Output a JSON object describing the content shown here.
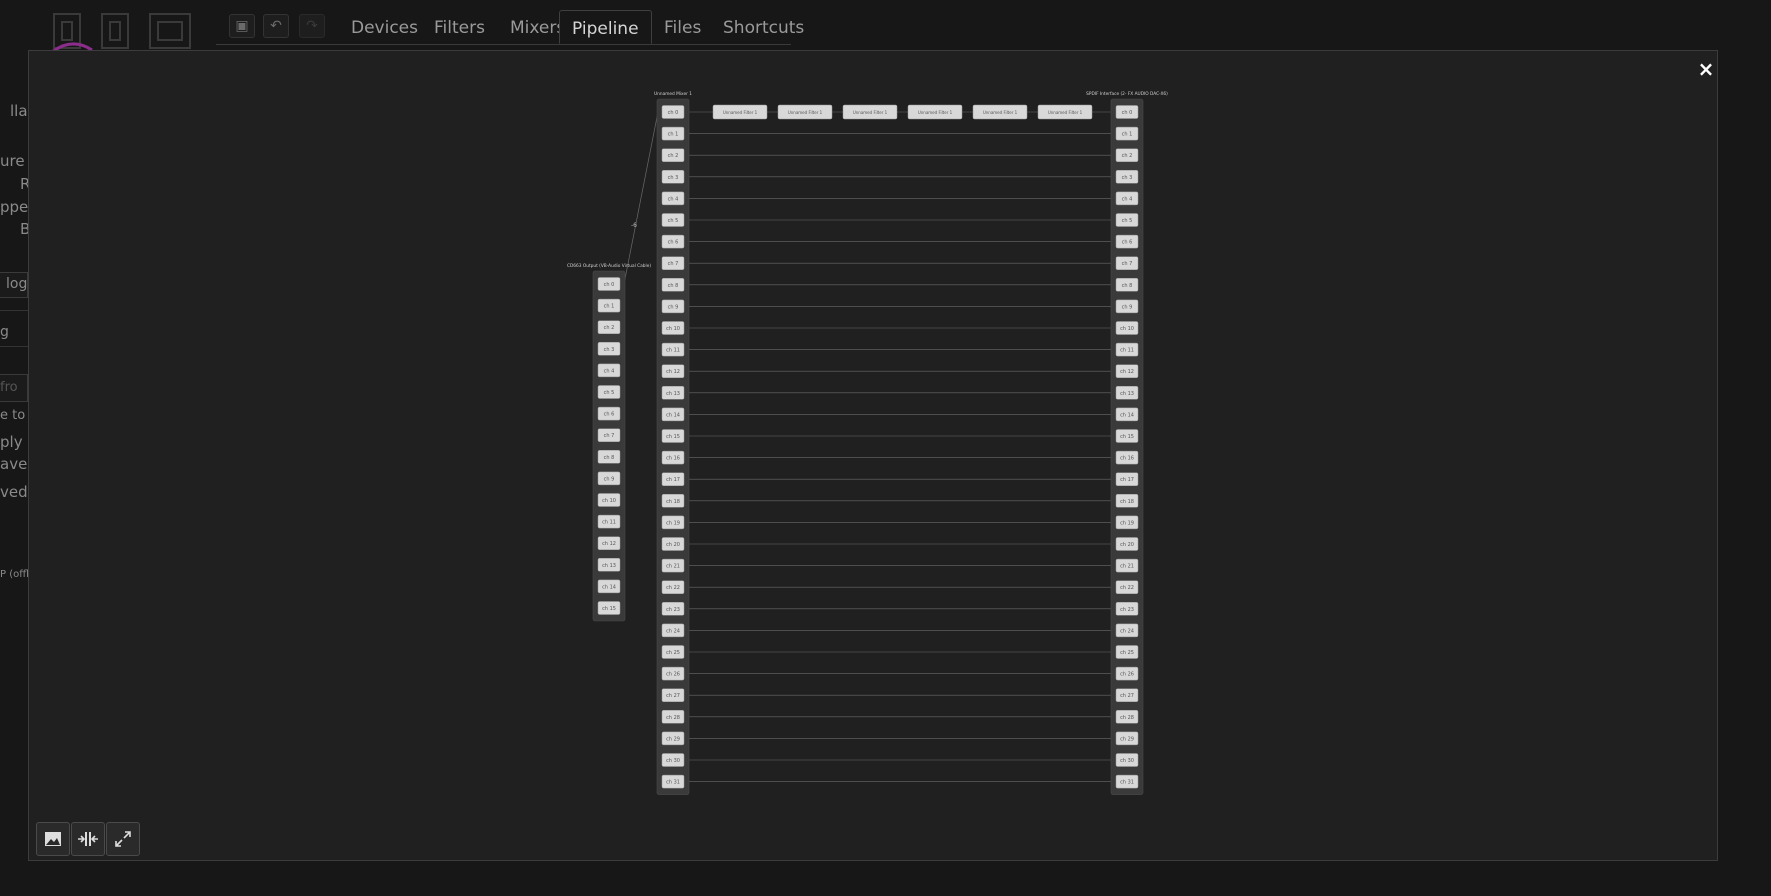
{
  "toolbar": {
    "icons": [
      "compact-view-icon",
      "undo-icon",
      "redo-icon"
    ]
  },
  "tabs": [
    {
      "label": "Devices"
    },
    {
      "label": "Filters"
    },
    {
      "label": "Mixers"
    },
    {
      "label": "Pipeline",
      "active": true
    },
    {
      "label": "Files"
    },
    {
      "label": "Shortcuts"
    }
  ],
  "background_text": [
    "llaDS",
    "ure s",
    "R",
    "ppe",
    "B",
    "log",
    "g",
    "fro",
    "e to",
    "ply",
    "ave",
    "ved",
    "P (offlin"
  ],
  "modal": {
    "close_label": "×",
    "mixer": {
      "title": "Unnamed Mixer 1",
      "channels": [
        "ch 0",
        "ch 1",
        "ch 2",
        "ch 3",
        "ch 4",
        "ch 5",
        "ch 6",
        "ch 7",
        "ch 8",
        "ch 9",
        "ch 10",
        "ch 11",
        "ch 12",
        "ch 13",
        "ch 14",
        "ch 15",
        "ch 16",
        "ch 17",
        "ch 18",
        "ch 19",
        "ch 20",
        "ch 21",
        "ch 22",
        "ch 23",
        "ch 24",
        "ch 25",
        "ch 26",
        "ch 27",
        "ch 28",
        "ch 29",
        "ch 30",
        "ch 31"
      ]
    },
    "capture": {
      "title": "CD663 Output (VB-Audio Virtual Cable)",
      "channels": [
        "ch 0",
        "ch 1",
        "ch 2",
        "ch 3",
        "ch 4",
        "ch 5",
        "ch 6",
        "ch 7",
        "ch 8",
        "ch 9",
        "ch 10",
        "ch 11",
        "ch 12",
        "ch 13",
        "ch 14",
        "ch 15"
      ]
    },
    "playback": {
      "title": "SPDIF Interface (2- FX AUDIO DAC-X6)",
      "channels": [
        "ch 0",
        "ch 1",
        "ch 2",
        "ch 3",
        "ch 4",
        "ch 5",
        "ch 6",
        "ch 7",
        "ch 8",
        "ch 9",
        "ch 10",
        "ch 11",
        "ch 12",
        "ch 13",
        "ch 14",
        "ch 15",
        "ch 16",
        "ch 17",
        "ch 18",
        "ch 19",
        "ch 20",
        "ch 21",
        "ch 22",
        "ch 23",
        "ch 24",
        "ch 25",
        "ch 26",
        "ch 27",
        "ch 28",
        "ch 29",
        "ch 30",
        "ch 31"
      ]
    },
    "filters": [
      "Unnamed Filter 1",
      "Unnamed Filter 1",
      "Unnamed Filter 1",
      "Unnamed Filter 1",
      "Unnamed Filter 1",
      "Unnamed Filter 1"
    ],
    "link_label": "-6",
    "controls": [
      "image-export-icon",
      "compact-layout-icon",
      "fullscreen-icon"
    ]
  }
}
